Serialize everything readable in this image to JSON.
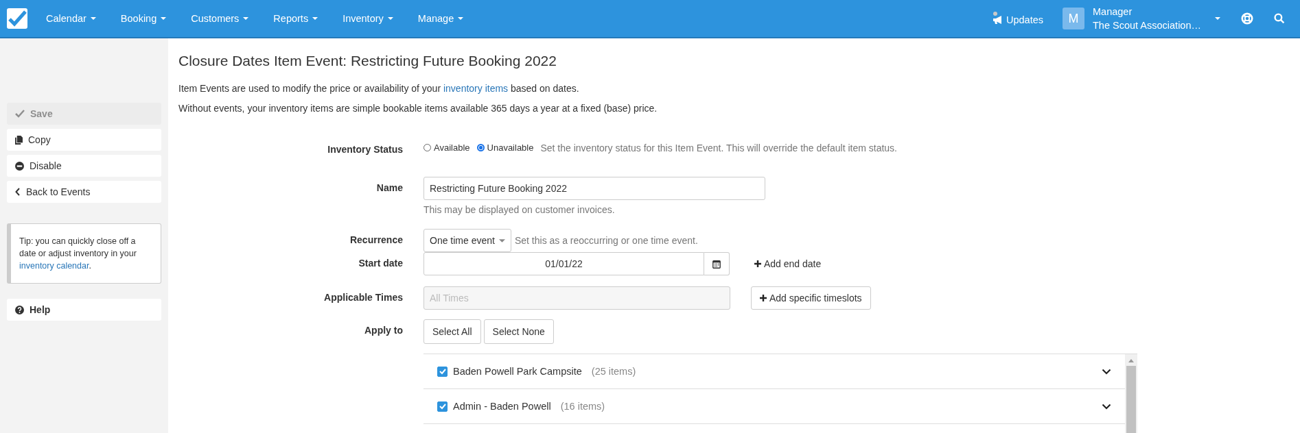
{
  "navbar": {
    "menus": [
      {
        "label": "Calendar"
      },
      {
        "label": "Booking"
      },
      {
        "label": "Customers"
      },
      {
        "label": "Reports"
      },
      {
        "label": "Inventory"
      },
      {
        "label": "Manage"
      }
    ],
    "updates": {
      "label": "Updates"
    },
    "user": {
      "initial": "M",
      "role": "Manager",
      "organisation": "The Scout Association…"
    }
  },
  "sidebar": {
    "actions": [
      {
        "label": "Save",
        "kind": "check",
        "disabled": true
      },
      {
        "label": "Copy",
        "kind": "copy",
        "disabled": false
      },
      {
        "label": "Disable",
        "kind": "minus-circle",
        "disabled": false
      },
      {
        "label": "Back to Events",
        "kind": "chevron-left",
        "disabled": false
      }
    ],
    "tip": {
      "text": "Tip: you can quickly close off a date or adjust inventory in your ",
      "link": "inventory calendar",
      "after": "."
    },
    "help": {
      "label": "Help"
    }
  },
  "page": {
    "title": "Closure Dates Item Event: Restricting Future Booking 2022",
    "intro": {
      "before": "Item Events are used to modify the price or availability of your ",
      "link": "inventory items",
      "after": " based on dates."
    },
    "note": "Without events, your inventory items are simple bookable items available 365 days a year at a fixed (base) price."
  },
  "form": {
    "inventory_status": {
      "label": "Inventory Status",
      "options": [
        {
          "label": "Available",
          "selected": false
        },
        {
          "label": "Unavailable",
          "selected": true
        }
      ],
      "hint": "Set the inventory status for this Item Event. This will override the default item status."
    },
    "name": {
      "label": "Name",
      "value": "Restricting Future Booking 2022",
      "hint": "This may be displayed on customer invoices."
    },
    "recurrence": {
      "label": "Recurrence",
      "value": "One time event",
      "hint": "Set this as a reoccurring or one time event."
    },
    "start_date": {
      "label": "Start date",
      "value": "01/01/22",
      "add_end_date": "Add end date"
    },
    "applicable_times": {
      "label": "Applicable Times",
      "placeholder": "All Times",
      "add_button": "Add specific timeslots"
    },
    "apply_to": {
      "label": "Apply to",
      "buttons": [
        "Select All",
        "Select None"
      ],
      "groups": [
        {
          "name": "Baden Powell Park Campsite",
          "count": "(25 items)",
          "checked": true
        },
        {
          "name": "Admin - Baden Powell",
          "count": "(16 items)",
          "checked": true
        }
      ]
    }
  }
}
